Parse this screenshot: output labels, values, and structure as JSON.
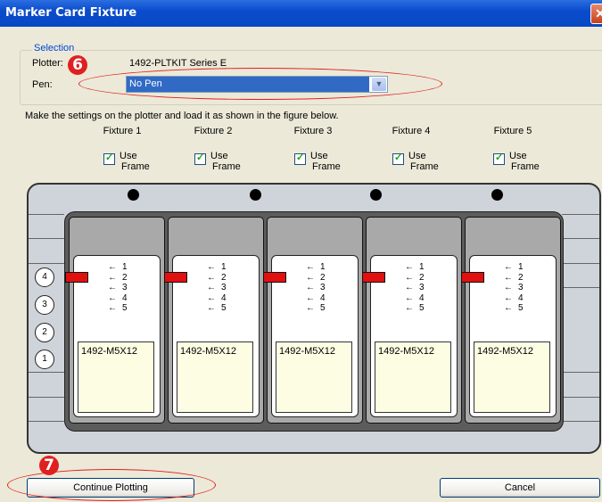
{
  "window": {
    "title": "Marker Card Fixture",
    "close_symbol": "✕"
  },
  "selection": {
    "legend": "Selection",
    "plotter_label": "Plotter:",
    "plotter_value": "1492-PLTKIT Series E",
    "pen_label": "Pen:",
    "pen_value": "No Pen"
  },
  "instructions": "Make the settings on the plotter and load it as shown in the figure below.",
  "fixtures": [
    {
      "name": "Fixture 1",
      "use": "Use",
      "frame": "Frame",
      "use_frame_checked": true,
      "card_label": "1492-M5X12"
    },
    {
      "name": "Fixture 2",
      "use": "Use",
      "frame": "Frame",
      "use_frame_checked": true,
      "card_label": "1492-M5X12"
    },
    {
      "name": "Fixture 3",
      "use": "Use",
      "frame": "Frame",
      "use_frame_checked": true,
      "card_label": "1492-M5X12"
    },
    {
      "name": "Fixture 4",
      "use": "Use",
      "frame": "Frame",
      "use_frame_checked": true,
      "card_label": "1492-M5X12"
    },
    {
      "name": "Fixture 5",
      "use": "Use",
      "frame": "Frame",
      "use_frame_checked": true,
      "card_label": "1492-M5X12"
    }
  ],
  "card_positions": [
    "1",
    "2",
    "3",
    "4",
    "5"
  ],
  "marker_position": "2",
  "side_positions": [
    "4",
    "3",
    "2",
    "1"
  ],
  "annotations": {
    "step_6": "6",
    "step_7": "7"
  },
  "buttons": {
    "continue": "Continue Plotting",
    "cancel": "Cancel"
  },
  "colors": {
    "title_bar": "#0a4ccc",
    "annotation": "#e02020",
    "marker": "#e01010",
    "selected_pen_bg": "#316ac5"
  }
}
